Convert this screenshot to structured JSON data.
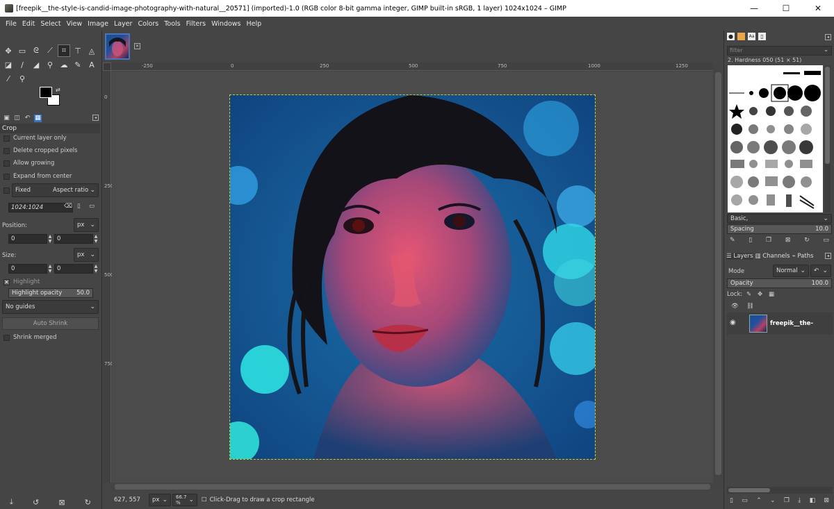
{
  "window": {
    "title": "[freepik__the-style-is-candid-image-photography-with-natural__20571] (imported)-1.0 (RGB color 8-bit gamma integer, GIMP built-in sRGB, 1 layer) 1024x1024 – GIMP",
    "minimize": "—",
    "maximize": "☐",
    "close": "✕"
  },
  "menu": [
    "File",
    "Edit",
    "Select",
    "View",
    "Image",
    "Layer",
    "Colors",
    "Tools",
    "Filters",
    "Windows",
    "Help"
  ],
  "tool_options": {
    "section_title": "Crop",
    "current_layer_only": "Current layer only",
    "delete_cropped": "Delete cropped pixels",
    "allow_growing": "Allow growing",
    "expand_from_center": "Expand from center",
    "fixed_label": "Fixed",
    "fixed_mode": "Aspect ratio",
    "ratio_value": "1024:1024",
    "position_label": "Position:",
    "position_unit": "px",
    "position_x": "0",
    "position_y": "0",
    "size_label": "Size:",
    "size_unit": "px",
    "size_w": "0",
    "size_h": "0",
    "highlight": "Highlight",
    "highlight_opacity_label": "Highlight opacity",
    "highlight_opacity_value": "50.0",
    "guides": "No guides",
    "auto_shrink": "Auto Shrink",
    "shrink_merged": "Shrink merged"
  },
  "rulers": {
    "h_ticks": [
      "-250",
      "0",
      "250",
      "500",
      "750",
      "1000",
      "1250"
    ],
    "v_ticks": [
      "0",
      "250",
      "500",
      "750"
    ]
  },
  "status": {
    "coords": "627, 557",
    "unit": "px",
    "zoom": "66.7 %",
    "message": "Click-Drag to draw a crop rectangle"
  },
  "brushes": {
    "filter_placeholder": "filter",
    "current": "2. Hardness 050 (51 × 51)",
    "tag": "Basic,",
    "spacing_label": "Spacing",
    "spacing_value": "10.0"
  },
  "layers": {
    "tabs": [
      "Layers",
      "Channels",
      "Paths"
    ],
    "mode_label": "Mode",
    "mode_value": "Normal",
    "opacity_label": "Opacity",
    "opacity_value": "100.0",
    "lock_label": "Lock:",
    "layer_name": "freepik__the-"
  }
}
